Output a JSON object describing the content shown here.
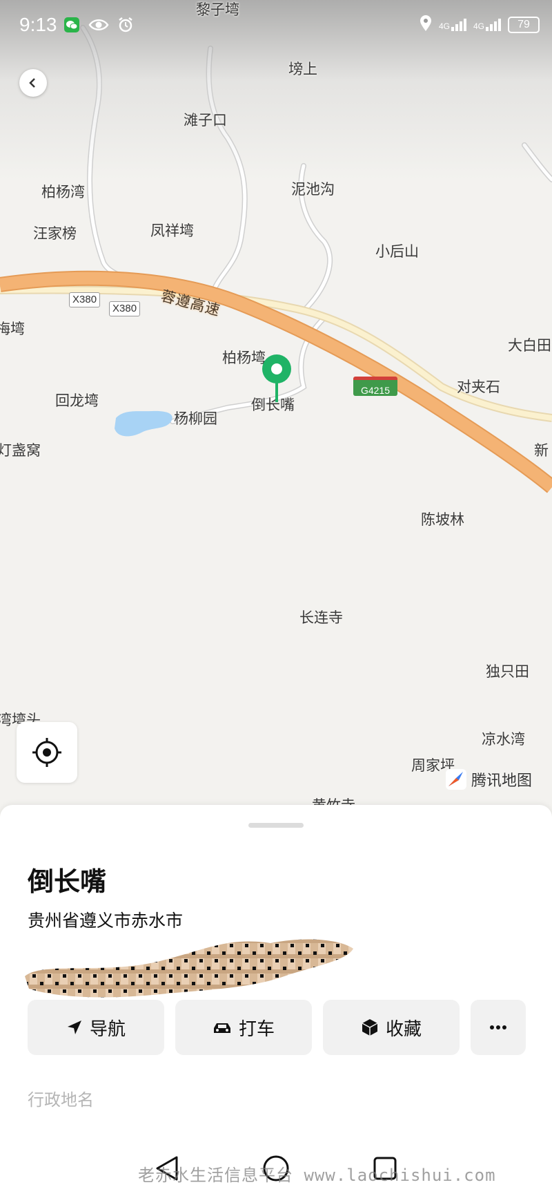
{
  "status": {
    "time": "9:13",
    "signal1": "4G",
    "signal2": "4G",
    "battery": "79",
    "icons_left": [
      "wechat-icon",
      "eye-icon",
      "alarm-icon"
    ],
    "icons_right": [
      "location-icon",
      "signal-icon",
      "signal-icon",
      "battery-icon"
    ]
  },
  "map": {
    "places": [
      {
        "name": "黎子塆"
      },
      {
        "name": "塝上"
      },
      {
        "name": "滩子口"
      },
      {
        "name": "柏杨湾"
      },
      {
        "name": "泥池沟"
      },
      {
        "name": "汪家榜"
      },
      {
        "name": "凤祥塆"
      },
      {
        "name": "小后山"
      },
      {
        "name": "梅塆"
      },
      {
        "name": "大白田"
      },
      {
        "name": "柏杨塆"
      },
      {
        "name": "对夹石"
      },
      {
        "name": "回龙塆"
      },
      {
        "name": "倒长嘴"
      },
      {
        "name": "杨柳园"
      },
      {
        "name": "灯盏窝"
      },
      {
        "name": "新"
      },
      {
        "name": "陈坡林"
      },
      {
        "name": "长连寺"
      },
      {
        "name": "独只田"
      },
      {
        "name": "湾塆头"
      },
      {
        "name": "凉水湾"
      },
      {
        "name": "周家坪"
      },
      {
        "name": "黄竹寺"
      }
    ],
    "road_tags": [
      "X380",
      "X380"
    ],
    "highway_badge": "G4215",
    "expressway_name": "蓉遵高速",
    "brand": "腾讯地图",
    "colors": {
      "expressway": "#f4b374",
      "road": "#ffffff",
      "water": "#a8d3f5",
      "pin": "#1fb366"
    }
  },
  "sheet": {
    "title": "倒长嘴",
    "address": "贵州省遵义市赤水市",
    "more": "更多",
    "actions": [
      {
        "label": "导航",
        "icon": "navigation-arrow-icon"
      },
      {
        "label": "打车",
        "icon": "taxi-icon"
      },
      {
        "label": "收藏",
        "icon": "favorite-box-icon"
      }
    ],
    "more_actions_icon": "ellipsis-icon",
    "category": "行政地名"
  },
  "watermark": "老赤水生活信息平台 www.laochishui.com"
}
